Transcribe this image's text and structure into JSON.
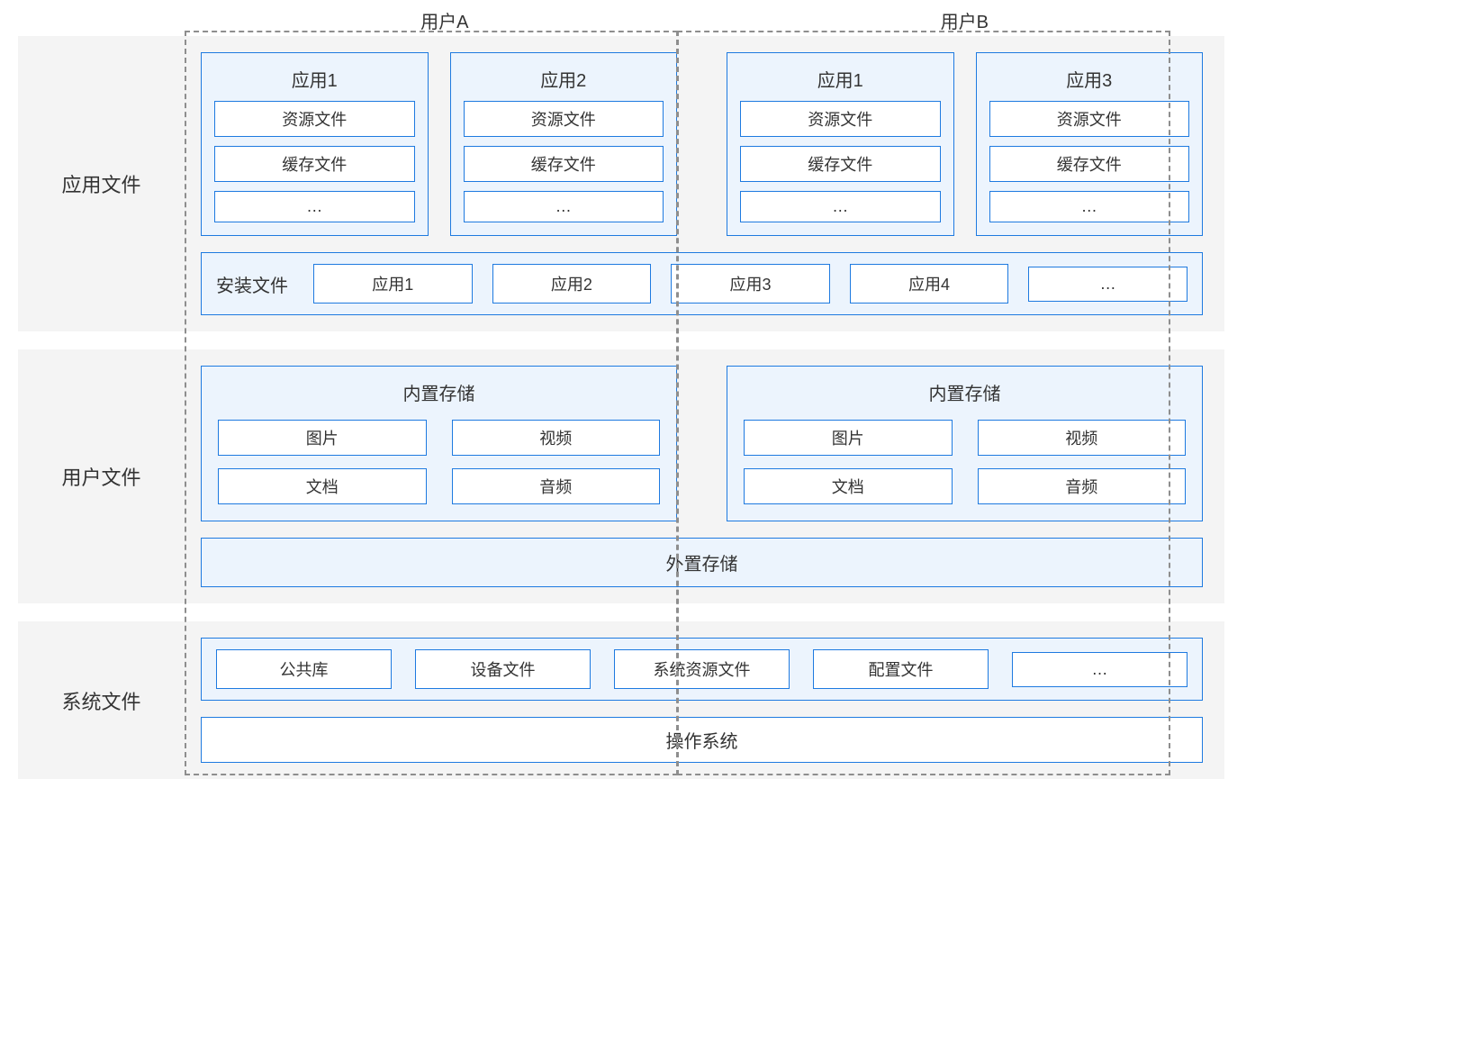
{
  "users": {
    "a": "用户A",
    "b": "用户B"
  },
  "sections": {
    "app": "应用文件",
    "user": "用户文件",
    "sys": "系统文件"
  },
  "apps": {
    "a": [
      {
        "title": "应用1",
        "items": [
          "资源文件",
          "缓存文件",
          "…"
        ]
      },
      {
        "title": "应用2",
        "items": [
          "资源文件",
          "缓存文件",
          "…"
        ]
      }
    ],
    "b": [
      {
        "title": "应用1",
        "items": [
          "资源文件",
          "缓存文件",
          "…"
        ]
      },
      {
        "title": "应用3",
        "items": [
          "资源文件",
          "缓存文件",
          "…"
        ]
      }
    ]
  },
  "install": {
    "label": "安装文件",
    "items": [
      "应用1",
      "应用2",
      "应用3",
      "应用4",
      "…"
    ]
  },
  "storage": {
    "title": "内置存储",
    "items": [
      "图片",
      "视频",
      "文档",
      "音频"
    ]
  },
  "external": "外置存储",
  "sysline": [
    "公共库",
    "设备文件",
    "系统资源文件",
    "配置文件",
    "…"
  ],
  "os": "操作系统"
}
